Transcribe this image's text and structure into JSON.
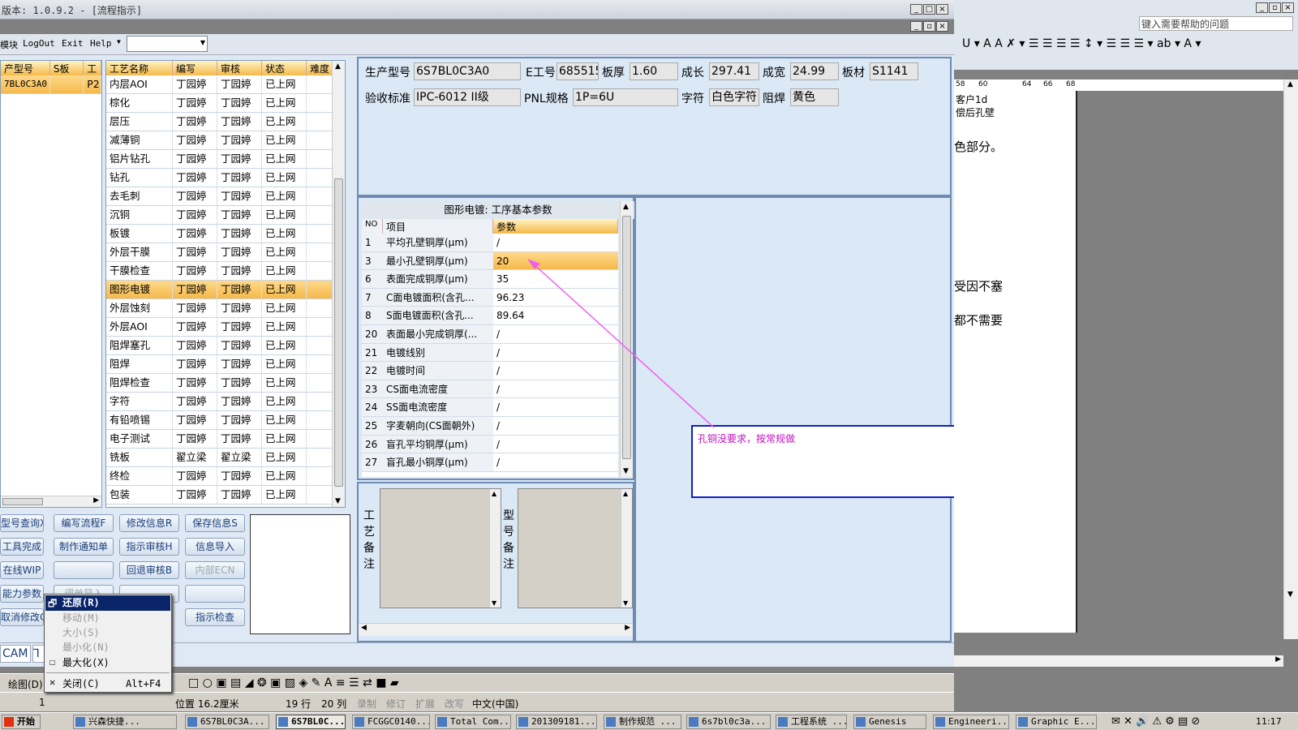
{
  "window": {
    "title": "版本: 1.0.9.2 - [流程指示]"
  },
  "menu": {
    "items": [
      "模块",
      "LogOut",
      "Exit",
      "Help"
    ],
    "combo_value": ""
  },
  "left_grid": {
    "headers": [
      "产型号",
      "S板",
      "工"
    ],
    "row": {
      "model": "7BL0C3A0",
      "s": "",
      "p": "P2"
    }
  },
  "process_grid": {
    "headers": [
      "工艺名称",
      "编写",
      "审核",
      "状态",
      "难度"
    ],
    "rows": [
      [
        "内层AOI",
        "丁园婷",
        "丁园婷",
        "已上网"
      ],
      [
        "棕化",
        "丁园婷",
        "丁园婷",
        "已上网"
      ],
      [
        "层压",
        "丁园婷",
        "丁园婷",
        "已上网"
      ],
      [
        "减薄铜",
        "丁园婷",
        "丁园婷",
        "已上网"
      ],
      [
        "铝片钻孔",
        "丁园婷",
        "丁园婷",
        "已上网"
      ],
      [
        "钻孔",
        "丁园婷",
        "丁园婷",
        "已上网"
      ],
      [
        "去毛刺",
        "丁园婷",
        "丁园婷",
        "已上网"
      ],
      [
        "沉铜",
        "丁园婷",
        "丁园婷",
        "已上网"
      ],
      [
        "板镀",
        "丁园婷",
        "丁园婷",
        "已上网"
      ],
      [
        "外层干膜",
        "丁园婷",
        "丁园婷",
        "已上网"
      ],
      [
        "干膜检查",
        "丁园婷",
        "丁园婷",
        "已上网"
      ],
      [
        "图形电镀",
        "丁园婷",
        "丁园婷",
        "已上网"
      ],
      [
        "外层蚀刻",
        "丁园婷",
        "丁园婷",
        "已上网"
      ],
      [
        "外层AOI",
        "丁园婷",
        "丁园婷",
        "已上网"
      ],
      [
        "阻焊塞孔",
        "丁园婷",
        "丁园婷",
        "已上网"
      ],
      [
        "阻焊",
        "丁园婷",
        "丁园婷",
        "已上网"
      ],
      [
        "阻焊检查",
        "丁园婷",
        "丁园婷",
        "已上网"
      ],
      [
        "字符",
        "丁园婷",
        "丁园婷",
        "已上网"
      ],
      [
        "有铅喷锡",
        "丁园婷",
        "丁园婷",
        "已上网"
      ],
      [
        "电子测试",
        "丁园婷",
        "丁园婷",
        "已上网"
      ],
      [
        "铣板",
        "翟立梁",
        "翟立梁",
        "已上网"
      ],
      [
        "终检",
        "丁园婷",
        "丁园婷",
        "已上网"
      ],
      [
        "包装",
        "丁园婷",
        "丁园婷",
        "已上网"
      ]
    ],
    "selected_index": 11
  },
  "info": {
    "model_label": "生产型号",
    "model": "6S7BL0C3A0",
    "eno_label": "E工号",
    "eno": "685515",
    "thick_label": "板厚",
    "thick": "1.60",
    "len_label": "成长",
    "len": "297.41",
    "width_label": "成宽",
    "width": "24.99",
    "mat_label": "板材",
    "mat": "S1141",
    "std_label": "验收标准",
    "std": "IPC-6012 II级",
    "pnl_label": "PNL规格",
    "pnl": "1P=6U",
    "char_label": "字符",
    "char": "白色字符",
    "mask_label": "阻焊",
    "mask": "黄色"
  },
  "params": {
    "title": "图形电镀: 工序基本参数",
    "headers": [
      "NO",
      "项目",
      "参数"
    ],
    "rows": [
      [
        "1",
        "平均孔壁铜厚(μm)",
        "/"
      ],
      [
        "3",
        "最小孔壁铜厚(μm)",
        "20"
      ],
      [
        "6",
        "表面完成铜厚(μm)",
        "35"
      ],
      [
        "7",
        "C面电镀面积(含孔...",
        "96.23"
      ],
      [
        "8",
        "S面电镀面积(含孔...",
        "89.64"
      ],
      [
        "20",
        "表面最小完成铜厚(...",
        "/"
      ],
      [
        "21",
        "电镀线别",
        "/"
      ],
      [
        "22",
        "电镀时间",
        "/"
      ],
      [
        "23",
        "CS面电流密度",
        "/"
      ],
      [
        "24",
        "SS面电流密度",
        "/"
      ],
      [
        "25",
        "字麦朝向(CS面朝外)",
        "/"
      ],
      [
        "26",
        "盲孔平均铜厚(μm)",
        "/"
      ],
      [
        "27",
        "盲孔最小铜厚(μm)",
        "/"
      ]
    ],
    "selected_index": 1
  },
  "notes": {
    "process_label": "工艺备注",
    "model_label": "型号备注"
  },
  "annotation": {
    "text": "孔铜没要求，按常规做"
  },
  "buttons": {
    "r1": [
      "型号查询X",
      "编写流程F",
      "修改信息R",
      "保存信息S"
    ],
    "r2": [
      "工具完成",
      "制作通知单",
      "指示审核H",
      "信息导入"
    ],
    "r3": [
      "在线WIP",
      "",
      "回退审核B",
      "内部ECN"
    ],
    "r4": [
      "能力参数",
      "调单导入",
      "",
      ""
    ],
    "r5": [
      "取消修改C",
      "指示检查"
    ]
  },
  "tabs": [
    "CAM",
    "⅂"
  ],
  "context_menu": {
    "items": [
      {
        "label": "还原(R)",
        "shortcut": ""
      },
      {
        "label": "移动(M)",
        "shortcut": ""
      },
      {
        "label": "大小(S)",
        "shortcut": ""
      },
      {
        "label": "最小化(N)",
        "shortcut": ""
      },
      {
        "label": "最大化(X)",
        "shortcut": ""
      },
      {
        "label": "关闭(C)",
        "shortcut": "Alt+F4"
      }
    ]
  },
  "statusbar": {
    "draw": "绘图(D)",
    "pos": "位置 16.2厘米",
    "line": "19 行",
    "col": "20 列",
    "modes": [
      "录制",
      "修订",
      "扩展",
      "改写"
    ],
    "lang": "中文(中国)",
    "page": "1"
  },
  "word": {
    "help_placeholder": "键入需要帮助的问题",
    "ruler": [
      "58",
      "60",
      "64",
      "66",
      "68"
    ],
    "lines": [
      "客户1d",
      "偿后孔壁",
      "色部分。",
      "受因不塞",
      "都不需要"
    ]
  },
  "taskbar": {
    "start": "开始",
    "items": [
      "兴森快捷...",
      "6S7BL0C3A...",
      "6S7BL0C...",
      "FCGGC0140...",
      "Total Com...",
      "201309181...",
      "制作规范 ...",
      "6s7bl0c3a...",
      "工程系统 ...",
      "Genesis",
      "Engineeri...",
      "Graphic E..."
    ],
    "clock": "11:17"
  }
}
